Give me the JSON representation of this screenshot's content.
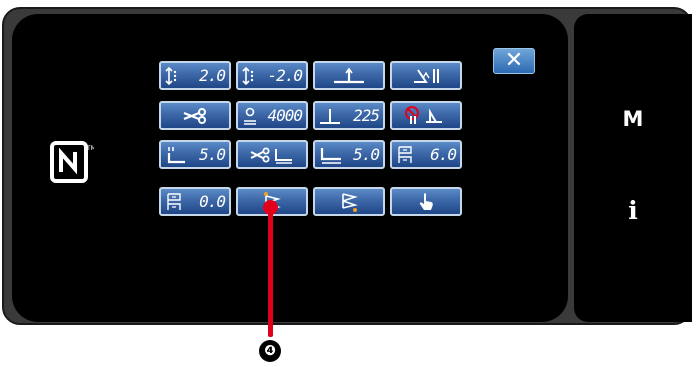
{
  "panel": {
    "close_label": "✕",
    "menu_label": "M",
    "info_label": "i",
    "nfc_icon": "nfc-icon"
  },
  "keys": [
    {
      "name": "stitch-length-front",
      "icon": "stitch-length-icon",
      "value": "2.0"
    },
    {
      "name": "stitch-length-back",
      "icon": "stitch-length-icon",
      "value": "-2.0"
    },
    {
      "name": "needle-position",
      "icon": "needle-up-icon",
      "value": ""
    },
    {
      "name": "presser-foot-lift",
      "icon": "presser-foot-lift-icon",
      "value": ""
    },
    {
      "name": "thread-trimmer",
      "icon": "scissors-icon",
      "value": ""
    },
    {
      "name": "sewing-speed",
      "icon": "speed-icon",
      "value": "4000"
    },
    {
      "name": "needle-stop",
      "icon": "needle-stop-icon",
      "value": "225"
    },
    {
      "name": "thread-wiper",
      "icon": "wiper-off-icon",
      "value": ""
    },
    {
      "name": "presser-foot-height",
      "icon": "presser-foot-icon",
      "value": "5.0"
    },
    {
      "name": "trim-foot-lift",
      "icon": "scissors-foot-icon",
      "value": ""
    },
    {
      "name": "foot-lift-amount",
      "icon": "presser-foot-up-icon",
      "value": "5.0"
    },
    {
      "name": "flag-length",
      "icon": "flag-icon",
      "value": "6.0"
    },
    {
      "name": "flag-compensation",
      "icon": "flag-compensation-icon",
      "value": "0.0"
    },
    {
      "name": "start-bartack",
      "icon": "start-flag-icon",
      "value": ""
    },
    {
      "name": "end-bartack",
      "icon": "end-flag-icon",
      "value": ""
    },
    {
      "name": "manual-operation",
      "icon": "hand-pointer-icon",
      "value": ""
    }
  ],
  "callout": {
    "number": "❹"
  },
  "colors": {
    "accent": "#e0001b",
    "key": "#3d68a8",
    "close": "#2b69b1"
  }
}
